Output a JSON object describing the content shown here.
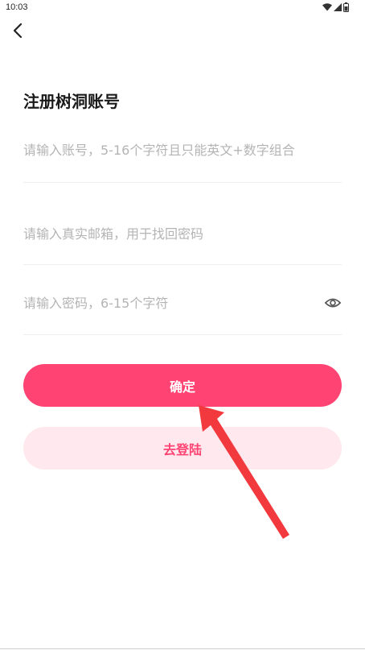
{
  "status_bar": {
    "time": "10:03",
    "icons": [
      "wifi-icon",
      "signal-icon",
      "battery-icon"
    ]
  },
  "header": {
    "back_icon": "chevron-left-icon"
  },
  "page": {
    "title": "注册树洞账号"
  },
  "form": {
    "account_placeholder": "请输入账号，5-16个字符且只能英文+数字组合",
    "email_placeholder": "请输入真实邮箱，用于找回密码",
    "password_placeholder": "请输入密码，6-15个字符",
    "password_toggle_icon": "eye-icon"
  },
  "actions": {
    "confirm_label": "确定",
    "login_label": "去登陆"
  },
  "colors": {
    "accent": "#ff4373",
    "secondary_bg": "#ffe8ee",
    "annotation": "#f23a3e"
  }
}
